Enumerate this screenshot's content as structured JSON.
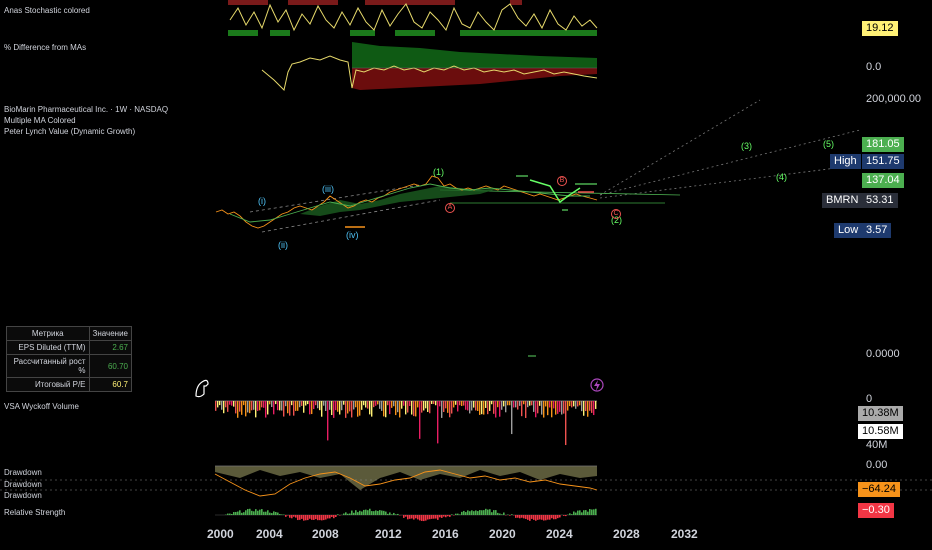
{
  "indicators": {
    "stochastic": "Anas Stochastic colored",
    "pct_diff": "% Difference from MAs",
    "symbol": "BioMarin Pharmaceutical Inc. · 1W · NASDAQ",
    "multi_ma": "Multiple MA Colored",
    "lynch": "Peter Lynch Value (Dynamic Growth)",
    "vsa": "VSA Wyckoff Volume",
    "drawdown": "Drawdown",
    "relative_strength": "Relative Strength"
  },
  "right_axis": {
    "stoch_value": "19.12",
    "pct_zero": "0.0",
    "top_price": "200,000.00",
    "target_5": "181.05",
    "high_label": "High",
    "high_value": "151.75",
    "target_4": "137.04",
    "symbol": "BMRN",
    "last_price": "53.31",
    "low_label": "Low",
    "low_value": "3.57",
    "zero": "0.0000",
    "vol_zero": "0",
    "vol_1": "10.38M",
    "vol_2": "10.58M",
    "vol_40m": "40M",
    "dd_zero": "0.00",
    "dd_value": "−64.24",
    "rs_value": "−0.30"
  },
  "colors": {
    "green": "#4caf50",
    "red": "#f23645",
    "orange": "#f7931a",
    "yellow": "#fff176",
    "navy": "#1e3a6e",
    "cyan": "#4fc3f7"
  },
  "waves": {
    "i": "(i)",
    "ii": "(ii)",
    "iii": "(iii)",
    "iv": "(iv)",
    "one": "(1)",
    "two": "(2)",
    "three": "(3)",
    "four": "(4)",
    "five": "(5)",
    "A": "A",
    "B": "B",
    "C": "C"
  },
  "metrics_table": {
    "header": [
      "Метрика",
      "Значение"
    ],
    "rows": [
      {
        "k": "EPS Diluted (TTM)",
        "v": "2.67",
        "color": "#4caf50"
      },
      {
        "k": "Рассчитанный рост %",
        "v": "60.70",
        "color": "#4caf50"
      },
      {
        "k": "Итоговый P/E",
        "v": "60.7",
        "color": "#fff176"
      }
    ]
  },
  "years": [
    "2000",
    "2004",
    "2008",
    "2012",
    "2016",
    "2020",
    "2024",
    "2028",
    "2032"
  ]
}
